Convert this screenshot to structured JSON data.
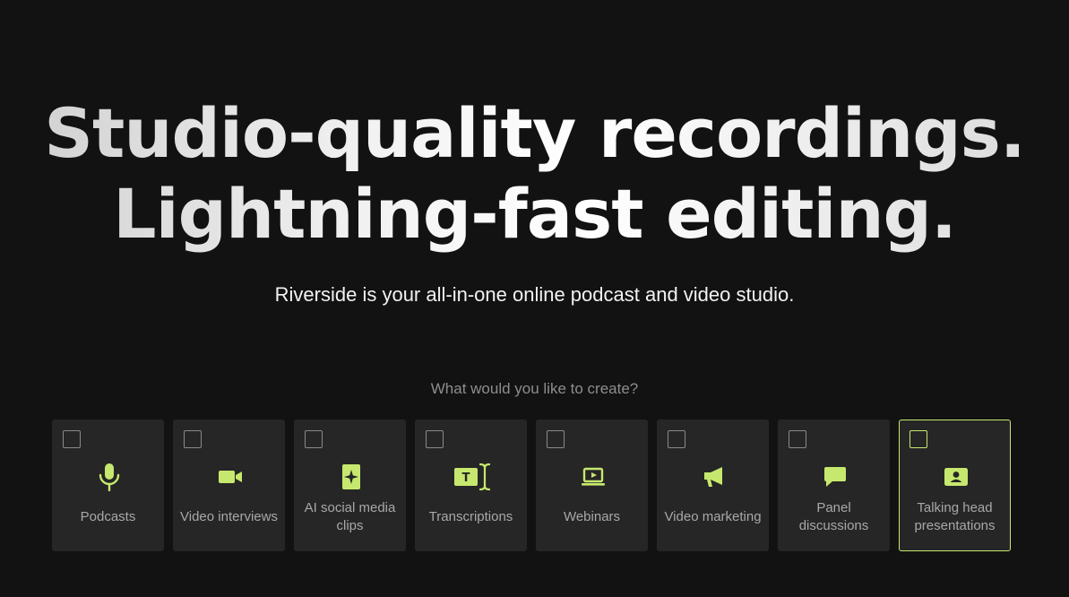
{
  "hero": {
    "line1": "Studio-quality recordings.",
    "line2": "Lightning-fast editing."
  },
  "subtitle": "Riverside is your all-in-one online podcast and video studio.",
  "question": "What would you like to create?",
  "accent_color": "#c7e86e",
  "cards": [
    {
      "label": "Podcasts",
      "icon": "microphone-icon"
    },
    {
      "label": "Video interviews",
      "icon": "video-camera-icon"
    },
    {
      "label": "AI social media clips",
      "icon": "sparkle-clip-icon"
    },
    {
      "label": "Transcriptions",
      "icon": "text-cursor-icon"
    },
    {
      "label": "Webinars",
      "icon": "laptop-play-icon"
    },
    {
      "label": "Video marketing",
      "icon": "megaphone-icon"
    },
    {
      "label": "Panel discussions",
      "icon": "chat-bubble-icon"
    },
    {
      "label": "Talking head presentations",
      "icon": "person-card-icon"
    }
  ]
}
